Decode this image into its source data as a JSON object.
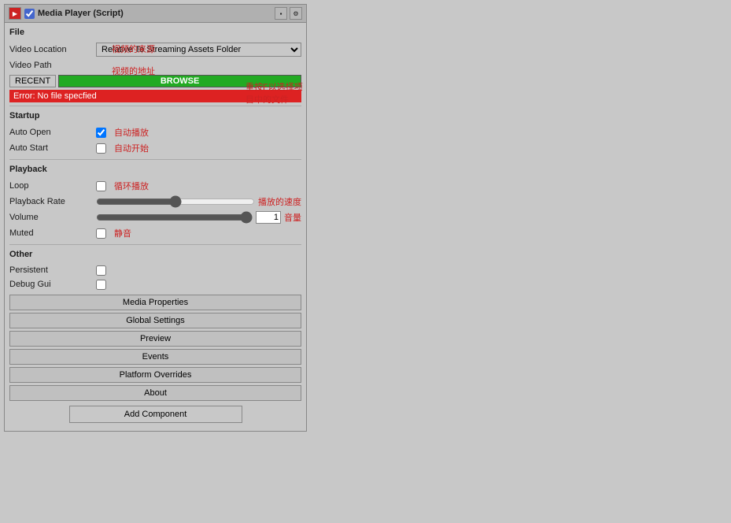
{
  "window": {
    "title": "Media Player (Script)",
    "icon": "media-icon",
    "buttons": {
      "settings": "⚙",
      "collapse": "▪"
    }
  },
  "file_section": {
    "header": "File",
    "video_location_label": "Video Location",
    "video_location_value": "Relative To Streaming Assets Folder",
    "video_location_annotation": "视频的来源",
    "video_path_label": "Video Path",
    "video_path_annotation": "视频的地址",
    "btn_recent": "RECENT",
    "btn_browse": "BROWSE",
    "browse_annotation": "重按F以选择项目中的文件",
    "error_text": "Error: No file specfied"
  },
  "startup_section": {
    "header": "Startup",
    "auto_open_label": "Auto Open",
    "auto_open_checked": true,
    "auto_open_annotation": "自动播放",
    "auto_start_label": "Auto Start",
    "auto_start_checked": false,
    "auto_start_annotation": "自动开始"
  },
  "playback_section": {
    "header": "Playback",
    "loop_label": "Loop",
    "loop_checked": false,
    "loop_annotation": "循环播放",
    "playback_rate_label": "Playback Rate",
    "playback_rate_annotation": "播放的速度",
    "volume_label": "Volume",
    "volume_value": "1",
    "volume_annotation": "音量",
    "muted_label": "Muted",
    "muted_checked": false,
    "muted_annotation": "静音"
  },
  "other_section": {
    "header": "Other",
    "persistent_label": "Persistent",
    "persistent_checked": false,
    "debug_gui_label": "Debug Gui",
    "debug_gui_checked": false
  },
  "buttons": {
    "media_properties": "Media Properties",
    "global_settings": "Global Settings",
    "preview": "Preview",
    "events": "Events",
    "platform_overrides": "Platform Overrides",
    "about": "About",
    "add_component": "Add Component"
  }
}
